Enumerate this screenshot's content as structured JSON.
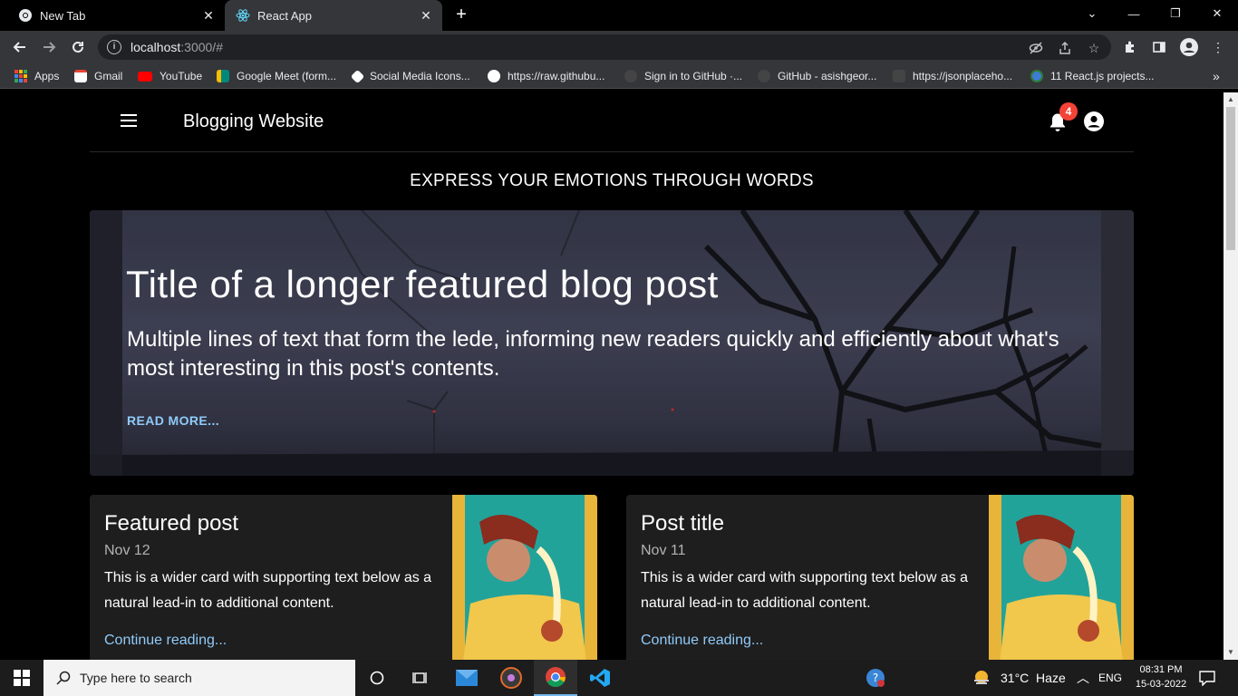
{
  "browser": {
    "tabs": [
      {
        "title": "New Tab",
        "active": false
      },
      {
        "title": "React App",
        "active": true
      }
    ],
    "url_host": "localhost",
    "url_rest": ":3000/#",
    "bookmarks": [
      {
        "label": "Apps",
        "icon": "apps-grid-icon",
        "color": "#e8eaed"
      },
      {
        "label": "Gmail",
        "icon": "gmail-icon",
        "color": "#ea4335"
      },
      {
        "label": "YouTube",
        "icon": "youtube-icon",
        "color": "#ff0000"
      },
      {
        "label": "Google Meet (form...",
        "icon": "meet-icon",
        "color": "#00897b"
      },
      {
        "label": "Social Media Icons...",
        "icon": "social-icon",
        "color": "#ffffff"
      },
      {
        "label": "https://raw.githubu...",
        "icon": "globe-icon",
        "color": "#ffffff"
      },
      {
        "label": "Sign in to GitHub ·...",
        "icon": "github-icon",
        "color": "#444444"
      },
      {
        "label": "GitHub - asishgeor...",
        "icon": "github-icon",
        "color": "#444444"
      },
      {
        "label": "https://jsonplaceho...",
        "icon": "placeholder-icon",
        "color": "#444444"
      },
      {
        "label": "11 React.js projects...",
        "icon": "react-projects-icon",
        "color": "#3f7bd6"
      }
    ]
  },
  "app": {
    "site_title": "Blogging Website",
    "notification_count": "4",
    "tagline": "EXPRESS YOUR EMOTIONS THROUGH WORDS",
    "hero": {
      "title": "Title of a longer featured blog post",
      "description": "Multiple lines of text that form the lede, informing new readers quickly and efficiently about what's most interesting in this post's contents.",
      "link": "READ MORE..."
    },
    "cards": [
      {
        "title": "Featured post",
        "date": "Nov 12",
        "text": "This is a wider card with supporting text below as a natural lead-in to additional content.",
        "link": "Continue reading..."
      },
      {
        "title": "Post title",
        "date": "Nov 11",
        "text": "This is a wider card with supporting text below as a natural lead-in to additional content.",
        "link": "Continue reading..."
      }
    ]
  },
  "taskbar": {
    "search_placeholder": "Type here to search",
    "weather": "31°C  Haze",
    "language": "ENG",
    "time": "08:31 PM",
    "date": "15-03-2022"
  },
  "colors": {
    "accent_link": "#90caf9",
    "badge": "#f44336",
    "card_bg": "#1e1e1e"
  }
}
